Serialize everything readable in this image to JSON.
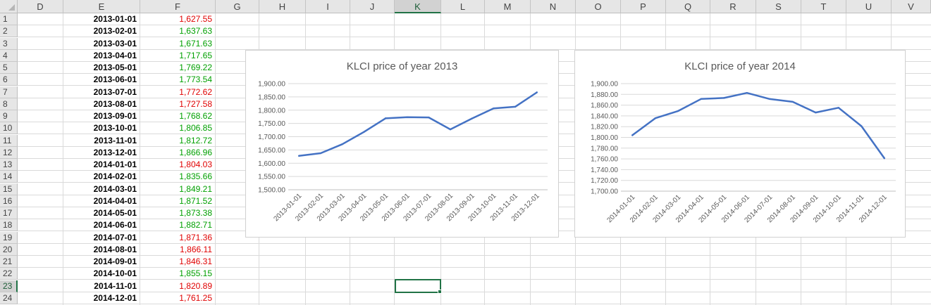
{
  "spreadsheet": {
    "columns": [
      "D",
      "E",
      "F",
      "G",
      "H",
      "I",
      "J",
      "K",
      "L",
      "M",
      "N",
      "O",
      "P",
      "Q",
      "R",
      "S",
      "T",
      "U",
      "V"
    ],
    "selected_column": "K",
    "rows": [
      "1",
      "2",
      "3",
      "4",
      "5",
      "6",
      "7",
      "8",
      "9",
      "10",
      "11",
      "12",
      "13",
      "14",
      "15",
      "16",
      "17",
      "18",
      "19",
      "20",
      "21",
      "22",
      "23",
      "24"
    ],
    "selected_row": "23",
    "data": [
      {
        "date": "2013-01-01",
        "price": "1,627.55",
        "trend": "down"
      },
      {
        "date": "2013-02-01",
        "price": "1,637.63",
        "trend": "up"
      },
      {
        "date": "2013-03-01",
        "price": "1,671.63",
        "trend": "up"
      },
      {
        "date": "2013-04-01",
        "price": "1,717.65",
        "trend": "up"
      },
      {
        "date": "2013-05-01",
        "price": "1,769.22",
        "trend": "up"
      },
      {
        "date": "2013-06-01",
        "price": "1,773.54",
        "trend": "up"
      },
      {
        "date": "2013-07-01",
        "price": "1,772.62",
        "trend": "down"
      },
      {
        "date": "2013-08-01",
        "price": "1,727.58",
        "trend": "down"
      },
      {
        "date": "2013-09-01",
        "price": "1,768.62",
        "trend": "up"
      },
      {
        "date": "2013-10-01",
        "price": "1,806.85",
        "trend": "up"
      },
      {
        "date": "2013-11-01",
        "price": "1,812.72",
        "trend": "up"
      },
      {
        "date": "2013-12-01",
        "price": "1,866.96",
        "trend": "up"
      },
      {
        "date": "2014-01-01",
        "price": "1,804.03",
        "trend": "down"
      },
      {
        "date": "2014-02-01",
        "price": "1,835.66",
        "trend": "up"
      },
      {
        "date": "2014-03-01",
        "price": "1,849.21",
        "trend": "up"
      },
      {
        "date": "2014-04-01",
        "price": "1,871.52",
        "trend": "up"
      },
      {
        "date": "2014-05-01",
        "price": "1,873.38",
        "trend": "up"
      },
      {
        "date": "2014-06-01",
        "price": "1,882.71",
        "trend": "up"
      },
      {
        "date": "2014-07-01",
        "price": "1,871.36",
        "trend": "down"
      },
      {
        "date": "2014-08-01",
        "price": "1,866.11",
        "trend": "down"
      },
      {
        "date": "2014-09-01",
        "price": "1,846.31",
        "trend": "down"
      },
      {
        "date": "2014-10-01",
        "price": "1,855.15",
        "trend": "up"
      },
      {
        "date": "2014-11-01",
        "price": "1,820.89",
        "trend": "down"
      },
      {
        "date": "2014-12-01",
        "price": "1,761.25",
        "trend": "down"
      }
    ]
  },
  "colors": {
    "up": "#00a000",
    "down": "#e00000",
    "line": "#4472c4",
    "grid": "#d9d9d9",
    "selection": "#217346"
  },
  "chart_data": [
    {
      "type": "line",
      "title": "KLCI price of year 2013",
      "categories": [
        "2013-01-01",
        "2013-02-01",
        "2013-03-01",
        "2013-04-01",
        "2013-05-01",
        "2013-06-01",
        "2013-07-01",
        "2013-08-01",
        "2013-09-01",
        "2013-10-01",
        "2013-11-01",
        "2013-12-01"
      ],
      "values": [
        1627.55,
        1637.63,
        1671.63,
        1717.65,
        1769.22,
        1773.54,
        1772.62,
        1727.58,
        1768.62,
        1806.85,
        1812.72,
        1866.96
      ],
      "ylim": [
        1500,
        1900
      ],
      "yticks": [
        "1,500.00",
        "1,550.00",
        "1,600.00",
        "1,650.00",
        "1,700.00",
        "1,750.00",
        "1,800.00",
        "1,850.00",
        "1,900.00"
      ],
      "grid": true,
      "legend": "none"
    },
    {
      "type": "line",
      "title": "KLCI price of year 2014",
      "categories": [
        "2014-01-01",
        "2014-02-01",
        "2014-03-01",
        "2014-04-01",
        "2014-05-01",
        "2014-06-01",
        "2014-07-01",
        "2014-08-01",
        "2014-09-01",
        "2014-10-01",
        "2014-11-01",
        "2014-12-01"
      ],
      "values": [
        1804.03,
        1835.66,
        1849.21,
        1871.52,
        1873.38,
        1882.71,
        1871.36,
        1866.11,
        1846.31,
        1855.15,
        1820.89,
        1761.25
      ],
      "ylim": [
        1700,
        1900
      ],
      "yticks": [
        "1,700.00",
        "1,720.00",
        "1,740.00",
        "1,760.00",
        "1,780.00",
        "1,800.00",
        "1,820.00",
        "1,840.00",
        "1,860.00",
        "1,880.00",
        "1,900.00"
      ],
      "grid": true,
      "legend": "none"
    }
  ]
}
